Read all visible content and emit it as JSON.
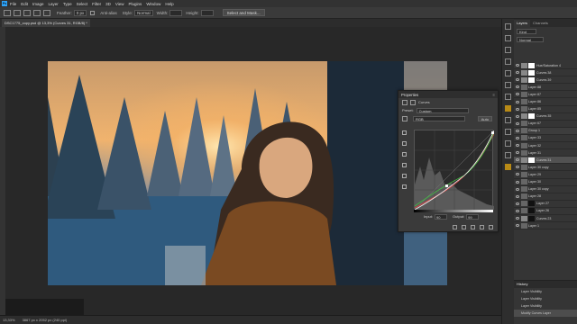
{
  "menubar": {
    "logo": "Ps",
    "items": [
      "File",
      "Edit",
      "Image",
      "Layer",
      "Type",
      "Select",
      "Filter",
      "3D",
      "View",
      "Plugins",
      "Window",
      "Help"
    ]
  },
  "options": {
    "feather_label": "Feather:",
    "feather_value": "0 px",
    "antialias_label": "Anti-alias",
    "style_label": "Style:",
    "style_value": "Normal",
    "width_label": "Width:",
    "height_label": "Height:",
    "select_mask_label": "Select and Mask..."
  },
  "document": {
    "tab_label": "DSC1775_copy.psd @ 13,3% (Curves 31, RGB/8) *",
    "zoom": "13,33%",
    "doc_info": "3867 px x 2052 px (240 ppi)"
  },
  "properties": {
    "title": "Properties",
    "type_label": "Curves",
    "preset_label": "Preset:",
    "preset_value": "Custom",
    "channel_value": "RGB",
    "auto_label": "Auto",
    "input_label": "Input:",
    "input_value": "90",
    "output_label": "Output:",
    "output_value": "99"
  },
  "layers_panel": {
    "tabs": [
      "Layers",
      "Channels"
    ],
    "kind_label": "Kind",
    "blend_mode": "Normal",
    "layers": [
      {
        "name": "Hue/Saturation 4",
        "type": "adj",
        "mask": "light",
        "active": false
      },
      {
        "name": "Curves 38",
        "type": "adj",
        "mask": "light",
        "active": false
      },
      {
        "name": "Curves 39",
        "type": "adj",
        "mask": "light",
        "active": false
      },
      {
        "name": "Layer 88",
        "type": "pixel",
        "mask": "",
        "active": false
      },
      {
        "name": "Layer 87",
        "type": "pixel",
        "mask": "",
        "active": false
      },
      {
        "name": "Layer 86",
        "type": "pixel",
        "mask": "",
        "active": false
      },
      {
        "name": "Layer 85",
        "type": "pixel",
        "mask": "",
        "active": false
      },
      {
        "name": "Curves 35",
        "type": "adj",
        "mask": "light",
        "active": false
      },
      {
        "name": "Layer 67",
        "type": "pixel",
        "mask": "",
        "active": false
      },
      {
        "name": "Group 1",
        "type": "group",
        "mask": "",
        "active": false
      },
      {
        "name": "Layer 33",
        "type": "pixel",
        "mask": "",
        "active": false
      },
      {
        "name": "Layer 32",
        "type": "pixel",
        "mask": "",
        "active": false
      },
      {
        "name": "Layer 31",
        "type": "pixel",
        "mask": "",
        "active": false
      },
      {
        "name": "Curves 31",
        "type": "adj",
        "mask": "light",
        "active": true
      },
      {
        "name": "Layer 30 copy",
        "type": "pixel",
        "mask": "",
        "active": false
      },
      {
        "name": "Layer 29",
        "type": "pixel",
        "mask": "",
        "active": false
      },
      {
        "name": "Layer 30",
        "type": "pixel",
        "mask": "",
        "active": false
      },
      {
        "name": "Layer 30 copy",
        "type": "pixel",
        "mask": "",
        "active": false
      },
      {
        "name": "Layer 28",
        "type": "pixel",
        "mask": "",
        "active": false
      },
      {
        "name": "Layer 27",
        "type": "pixel",
        "mask": "dark",
        "active": false
      },
      {
        "name": "Layer 26",
        "type": "pixel",
        "mask": "dark",
        "active": false
      },
      {
        "name": "Curves 23",
        "type": "adj",
        "mask": "dark",
        "active": false
      },
      {
        "name": "Layer 1",
        "type": "pixel",
        "mask": "",
        "active": false
      }
    ]
  },
  "history": {
    "title": "History",
    "items": [
      "Layer Visibility",
      "Layer Visibility",
      "Layer Visibility",
      "Modify Curves Layer"
    ]
  },
  "colors": {
    "accent": "#2fa3f7",
    "swatch": "#b88a16"
  }
}
